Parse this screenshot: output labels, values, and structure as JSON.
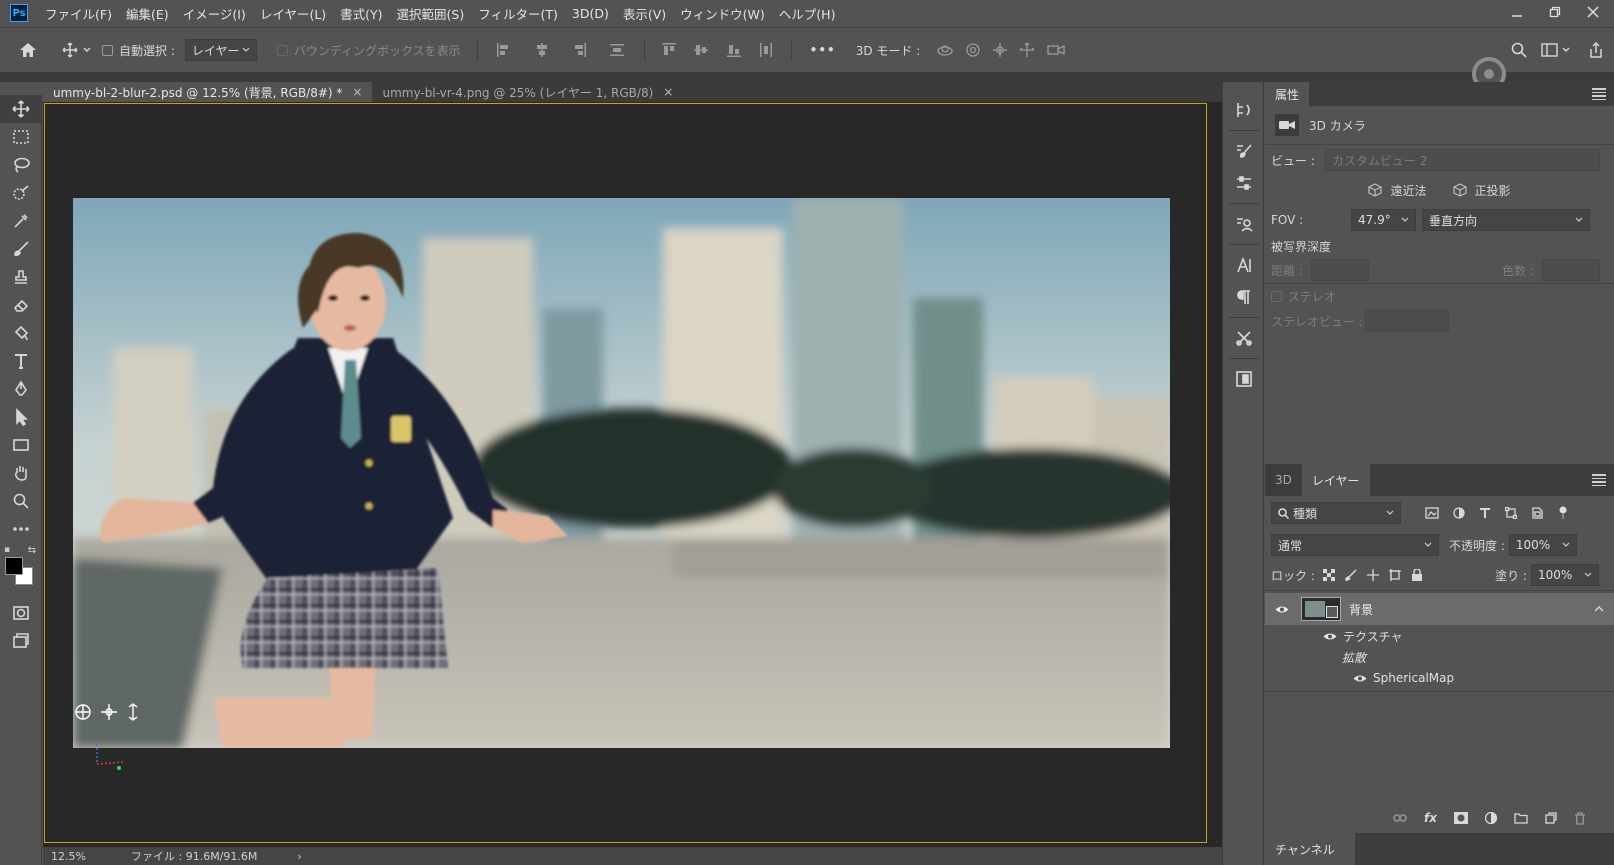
{
  "app": {
    "logo": "Ps"
  },
  "menu": [
    "ファイル(F)",
    "編集(E)",
    "イメージ(I)",
    "レイヤー(L)",
    "書式(Y)",
    "選択範囲(S)",
    "フィルター(T)",
    "3D(D)",
    "表示(V)",
    "ウィンドウ(W)",
    "ヘルプ(H)"
  ],
  "options": {
    "auto_select_label": "自動選択 :",
    "auto_select_target": "レイヤー",
    "bounding_box_label": "バウンディングボックスを表示",
    "more": "•••",
    "mode3d_label": "3D モード :"
  },
  "tabs": [
    {
      "title": "ummy-bl-2-blur-2.psd @ 12.5% (背景, RGB/8#) *",
      "close": "×"
    },
    {
      "title": "ummy-bl-vr-4.png @ 25% (レイヤー 1, RGB/8)",
      "close": "×"
    }
  ],
  "status": {
    "zoom": "12.5%",
    "file": "ファイル : 91.6M/91.6M",
    "arrow": "›"
  },
  "properties": {
    "tab": "属性",
    "type": "3D カメラ",
    "view_label": "ビュー :",
    "view_value": "カスタムビュー 2",
    "perspective": "遠近法",
    "orthographic": "正投影",
    "fov_label": "FOV :",
    "fov_value": "47.9°",
    "fov_direction": "垂直方向",
    "dof_label": "被写界深度",
    "distance_label": "距離 :",
    "blur_label": "色数 :",
    "stereo_label": "ステレオ",
    "stereo_view_label": "ステレオビュー :"
  },
  "layers": {
    "tabs": [
      "3D",
      "レイヤー"
    ],
    "filter_kind": "種類",
    "blend_mode": "通常",
    "opacity_label": "不透明度 :",
    "opacity_value": "100%",
    "lock_label": "ロック :",
    "fill_label": "塗り :",
    "fill_value": "100%",
    "layer_name": "背景",
    "sub_texture": "テクスチャ",
    "sub_diffuse": "拡散",
    "sub_map": "SphericalMap"
  },
  "channels": {
    "tab": "チャンネル"
  }
}
